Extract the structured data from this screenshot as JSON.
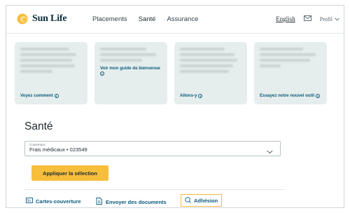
{
  "header": {
    "brand": "Sun Life",
    "nav": [
      "Placements",
      "Santé",
      "Assurance"
    ],
    "language": "English",
    "profile": "Profil"
  },
  "cards": [
    {
      "link": "Voyez comment"
    },
    {
      "link": "Voir mon guide de bienvenue"
    },
    {
      "link": "Allons-y"
    },
    {
      "link": "Essayez notre nouvel outil"
    }
  ],
  "page_title": "Santé",
  "coverage": {
    "label": "Couverture",
    "value": "Frais médicaux • 023549"
  },
  "apply_button": "Appliquer la sélection",
  "bottom_links": [
    "Cartes-couverture",
    "Envoyer des documents",
    "Adhésion"
  ],
  "colors": {
    "brand_yellow": "#f6be3a",
    "link_blue": "#0b5a7c",
    "card_bg": "#e6eeed"
  }
}
